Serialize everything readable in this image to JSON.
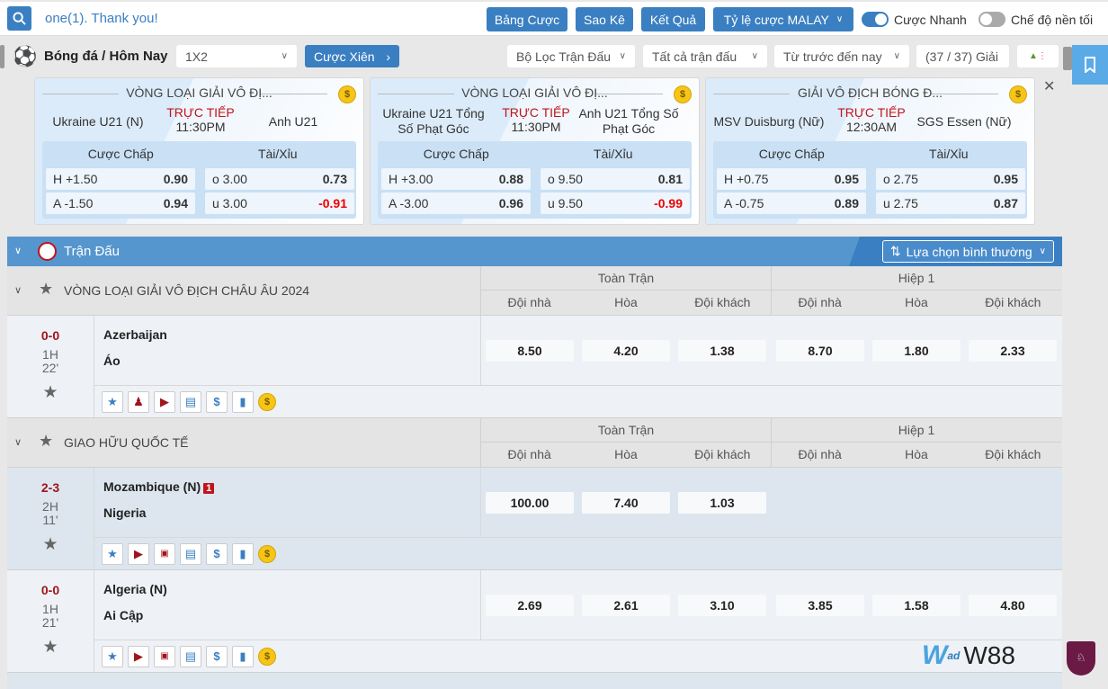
{
  "topbar": {
    "marquee": "one(1). Thank you!",
    "buttons": [
      "Bảng Cược",
      "Sao Kê",
      "Kết Quả",
      "Tỷ lệ cược MALAY"
    ],
    "quick_bet": "Cược Nhanh",
    "dark_mode": "Chế độ nền tối",
    "quick_bet_on": true,
    "dark_mode_on": false
  },
  "toolbar": {
    "sport": "Bóng đá / Hôm Nay",
    "market": "1X2",
    "parlay": "Cược Xiên",
    "filter": "Bộ Lọc Trận Đấu",
    "all_matches": "Tất cả trận đấu",
    "time": "Từ trước đến nay",
    "leagues": "(37 / 37) Giải"
  },
  "featured": [
    {
      "league": "VÒNG LOẠI GIẢI VÔ ĐỊ...",
      "home": "Ukraine U21 (N)",
      "away": "Anh U21",
      "status": "TRỰC TIẾP",
      "time": "11:30PM",
      "hdp_label": "Cược Chấp",
      "ou_label": "Tài/Xỉu",
      "h": "H +1.50",
      "h_odds": "0.90",
      "a": "A -1.50",
      "a_odds": "0.94",
      "o": "o 3.00",
      "o_odds": "0.73",
      "u": "u 3.00",
      "u_odds": "-0.91"
    },
    {
      "league": "VÒNG LOẠI GIẢI VÔ ĐỊ...",
      "home": "Ukraine U21 Tổng Số Phạt Góc",
      "away": "Anh U21 Tổng Số Phạt Góc",
      "status": "TRỰC TIẾP",
      "time": "11:30PM",
      "hdp_label": "Cược Chấp",
      "ou_label": "Tài/Xỉu",
      "h": "H +3.00",
      "h_odds": "0.88",
      "a": "A -3.00",
      "a_odds": "0.96",
      "o": "o 9.50",
      "o_odds": "0.81",
      "u": "u 9.50",
      "u_odds": "-0.99"
    },
    {
      "league": "GIẢI VÔ ĐỊCH BÓNG Đ...",
      "home": "MSV Duisburg (Nữ)",
      "away": "SGS Essen (Nữ)",
      "status": "TRỰC TIẾP",
      "time": "12:30AM",
      "hdp_label": "Cược Chấp",
      "ou_label": "Tài/Xỉu",
      "h": "H +0.75",
      "h_odds": "0.95",
      "a": "A -0.75",
      "a_odds": "0.89",
      "o": "o 2.75",
      "o_odds": "0.95",
      "u": "u 2.75",
      "u_odds": "0.87"
    }
  ],
  "main": {
    "title": "Trận Đấu",
    "view_option": "Lựa chọn bình thường",
    "full_time": "Toàn Trận",
    "first_half": "Hiệp 1",
    "cols": [
      "Đội nhà",
      "Hòa",
      "Đội khách"
    ]
  },
  "leagues": [
    {
      "name": "VÒNG LOẠI GIẢI VÔ ĐỊCH CHÂU ÂU 2024",
      "matches": [
        {
          "score": "0-0",
          "period": "1H",
          "minute": "22'",
          "home": "Azerbaijan",
          "away": "Áo",
          "red": "",
          "ft": [
            "8.50",
            "4.20",
            "1.38"
          ],
          "h1": [
            "8.70",
            "1.80",
            "2.33"
          ]
        }
      ]
    },
    {
      "name": "GIAO HỮU QUỐC TẾ",
      "matches": [
        {
          "score": "2-3",
          "period": "2H",
          "minute": "11'",
          "home": "Mozambique (N)",
          "away": "Nigeria",
          "red": "1",
          "ft": [
            "100.00",
            "7.40",
            "1.03"
          ],
          "h1": []
        },
        {
          "score": "0-0",
          "period": "1H",
          "minute": "21'",
          "home": "Algeria (N)",
          "away": "Ai Cập",
          "red": "",
          "ft": [
            "2.69",
            "2.61",
            "3.10"
          ],
          "h1": [
            "3.85",
            "1.58",
            "4.80"
          ]
        }
      ]
    }
  ],
  "watermark": {
    "brand": "W88",
    "ad": "ad"
  },
  "colors": {
    "accent": "#3a7fc1",
    "live": "#c0141b",
    "negative": "#e00000"
  }
}
